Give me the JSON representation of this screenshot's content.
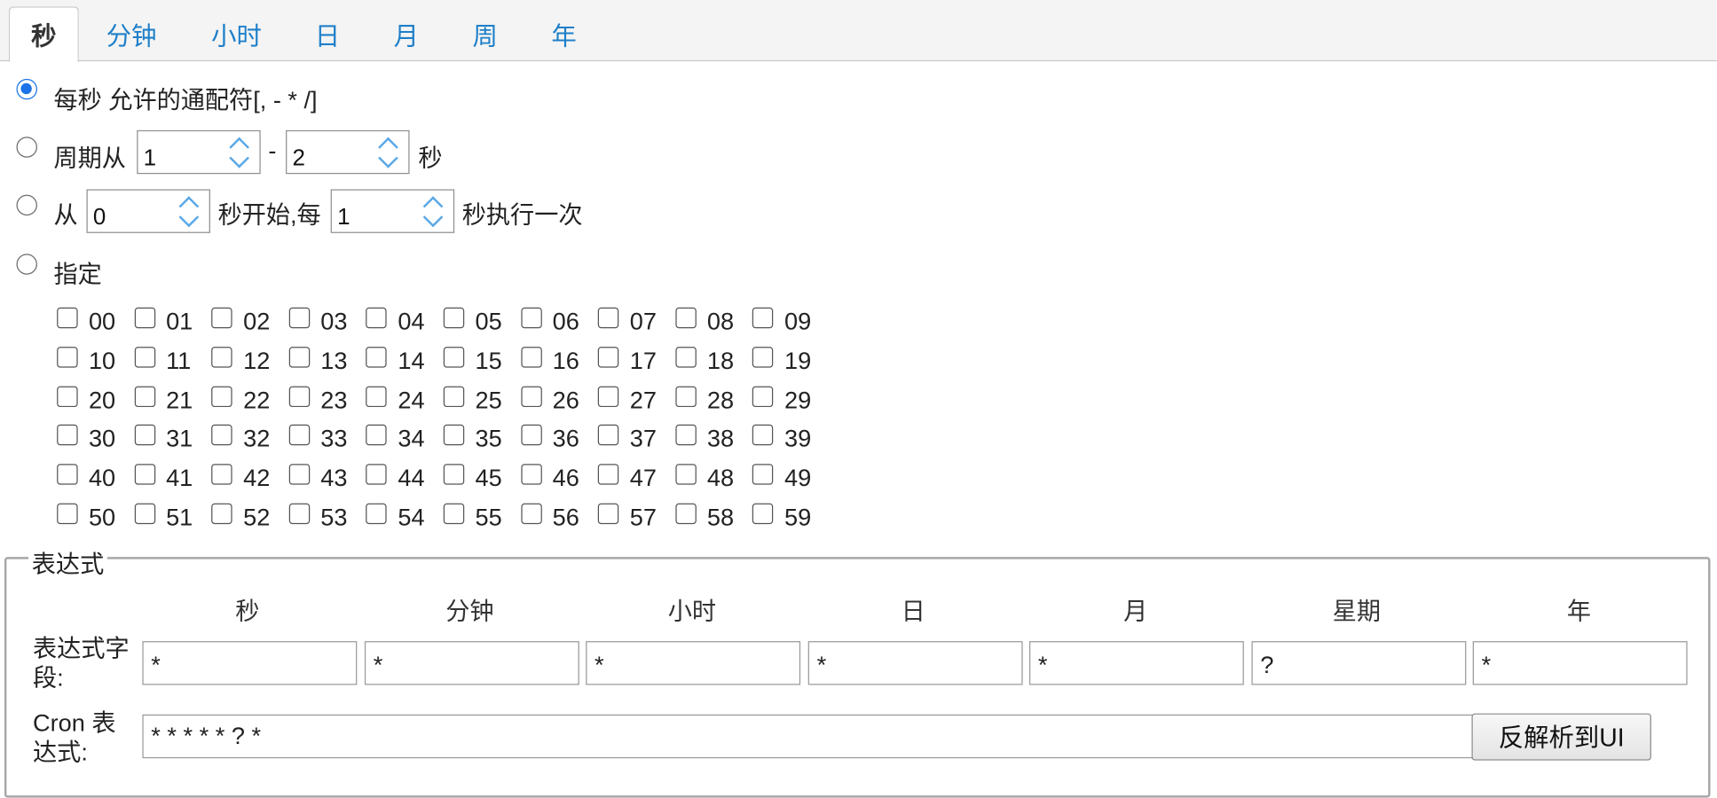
{
  "tabs": [
    {
      "label": "秒",
      "active": true
    },
    {
      "label": "分钟"
    },
    {
      "label": "小时"
    },
    {
      "label": "日"
    },
    {
      "label": "月"
    },
    {
      "label": "周"
    },
    {
      "label": "年"
    }
  ],
  "options": {
    "every": {
      "label": "每秒 允许的通配符[, - * /]",
      "selected": true
    },
    "cycle": {
      "prefix": "周期从",
      "from": "1",
      "dash": "-",
      "to": "2",
      "suffix": "秒"
    },
    "interval": {
      "prefix": "从",
      "start": "0",
      "middle": "秒开始,每",
      "step": "1",
      "suffix": "秒执行一次"
    },
    "specify": {
      "label": "指定"
    }
  },
  "seconds": [
    "00",
    "01",
    "02",
    "03",
    "04",
    "05",
    "06",
    "07",
    "08",
    "09",
    "10",
    "11",
    "12",
    "13",
    "14",
    "15",
    "16",
    "17",
    "18",
    "19",
    "20",
    "21",
    "22",
    "23",
    "24",
    "25",
    "26",
    "27",
    "28",
    "29",
    "30",
    "31",
    "32",
    "33",
    "34",
    "35",
    "36",
    "37",
    "38",
    "39",
    "40",
    "41",
    "42",
    "43",
    "44",
    "45",
    "46",
    "47",
    "48",
    "49",
    "50",
    "51",
    "52",
    "53",
    "54",
    "55",
    "56",
    "57",
    "58",
    "59"
  ],
  "expression": {
    "legend": "表达式",
    "columns": [
      "秒",
      "分钟",
      "小时",
      "日",
      "月",
      "星期",
      "年"
    ],
    "fields_label": "表达式字段:",
    "fields_label_lines": [
      "表达式字",
      "段:"
    ],
    "fields": [
      "*",
      "*",
      "*",
      "*",
      "*",
      "?",
      "*"
    ],
    "cron_label_lines": [
      "Cron 表",
      "达式:"
    ],
    "cron_value": "* * * * * ? *",
    "parse_button": "反解析到UI"
  }
}
